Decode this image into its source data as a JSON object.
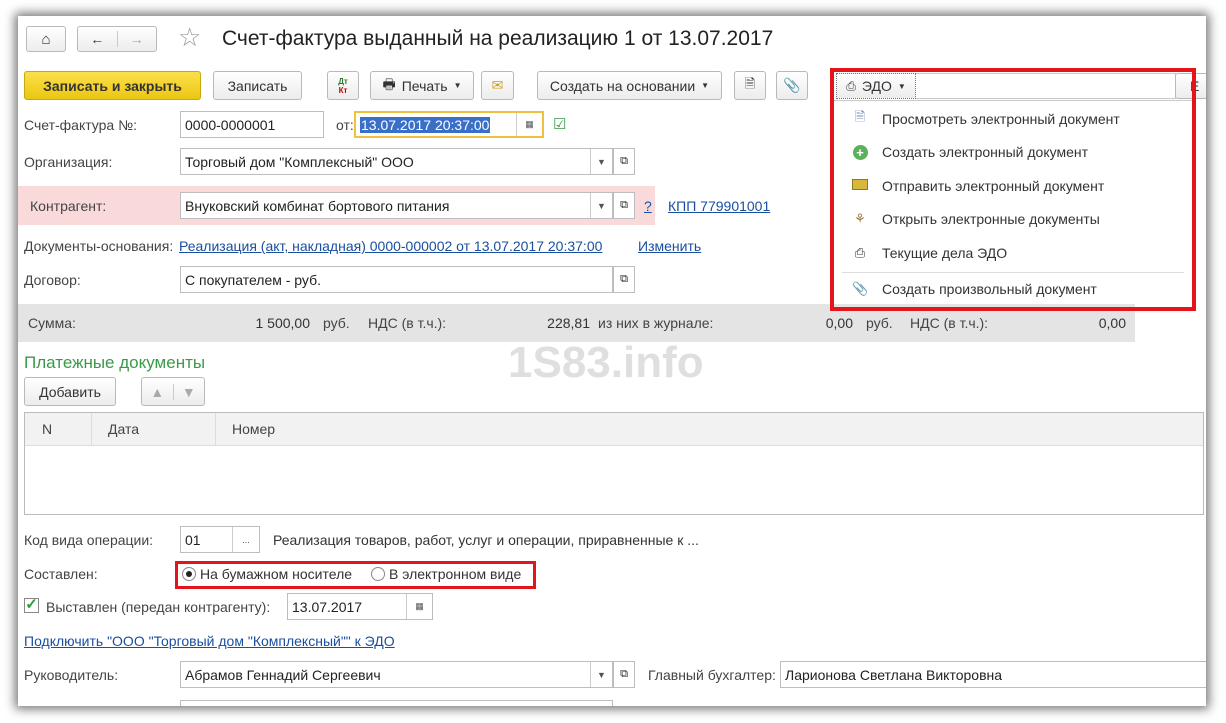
{
  "title": "Счет-фактура выданный на реализацию 1 от 13.07.2017",
  "toolbar": {
    "save_close": "Записать и закрыть",
    "save": "Записать",
    "dtkt_top": "Дт",
    "dtkt_bottom": "Кт",
    "print": "Печать",
    "create_based": "Создать на основании",
    "edo": "ЭДО",
    "more": "Е"
  },
  "edo_menu": [
    "Просмотреть электронный документ",
    "Создать электронный документ",
    "Отправить электронный документ",
    "Открыть электронные документы",
    "Текущие дела ЭДО",
    "Создать произвольный документ"
  ],
  "form": {
    "invoice_label": "Счет-фактура №:",
    "invoice_no": "0000-0000001",
    "from_label": "от:",
    "date": "13.07.2017 20:37:00",
    "org_label": "Организация:",
    "org": "Торговый дом \"Комплексный\" ООО",
    "contractor_label": "Контрагент:",
    "contractor": "Внуковский комбинат бортового питания",
    "help": "?",
    "kpp": "КПП 779901001",
    "base_docs_label": "Документы-основания:",
    "base_docs": "Реализация (акт, накладная) 0000-000002 от 13.07.2017 20:37:00",
    "change": "Изменить",
    "contract_label": "Договор:",
    "contract": "С покупателем - руб."
  },
  "sum": {
    "sum_label": "Сумма:",
    "sum": "1 500,00",
    "cur1": "руб.",
    "vat_label": "НДС (в т.ч.):",
    "vat": "228,81",
    "journal_label": "из них в журнале:",
    "journal": "0,00",
    "cur2": "руб.",
    "vat2_label": "НДС (в т.ч.):",
    "vat2": "0,00"
  },
  "watermark": "1S83.info",
  "payments": {
    "title": "Платежные документы",
    "add": "Добавить",
    "columns": [
      "N",
      "Дата",
      "Номер"
    ]
  },
  "bottom": {
    "op_code_label": "Код вида операции:",
    "op_code": "01",
    "op_dots": "...",
    "op_desc": "Реализация товаров, работ, услуг и операции, приравненные к ...",
    "composed_label": "Составлен:",
    "paper": "На бумажном носителе",
    "electronic": "В электронном виде",
    "issued_label": "Выставлен (передан контрагенту):",
    "issued_date": "13.07.2017",
    "connect_link": "Подключить \"ООО \"Торговый дом \"Комплексный\"\" к ЭДО",
    "head_label": "Руководитель:",
    "head": "Абрамов Геннадий Сергеевич",
    "accountant_label": "Главный бухгалтер:",
    "accountant": "Ларионова Светлана Викторовна"
  },
  "colors": {
    "accent_yellow": "#f5d21c",
    "highlight_red": "#e3141b",
    "link": "#1a4fa0",
    "section_green": "#3a9a48"
  }
}
